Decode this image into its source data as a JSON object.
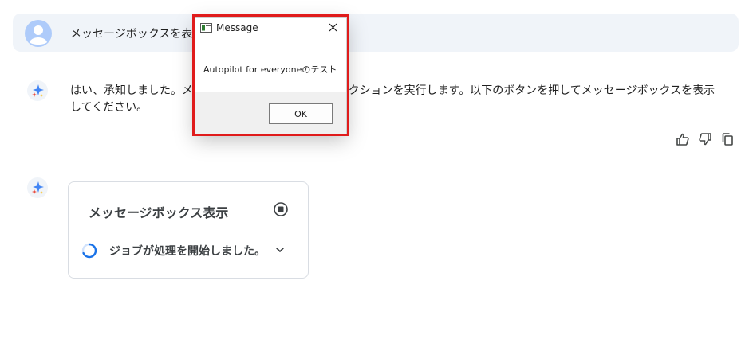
{
  "user_message": {
    "text": "メッセージボックスを表示して",
    "avatar_icon": "user-avatar-icon"
  },
  "assistant_reply": {
    "text": "はい、承知しました。メッセージボックスを表示するアクションを実行します。以下のボタンを押してメッセージボックスを表示してください。",
    "icon": "sparkle-icon",
    "actions": [
      "thumbs-up-icon",
      "thumbs-down-icon",
      "copy-icon"
    ]
  },
  "action_card": {
    "title": "メッセージボックス表示",
    "status": "ジョブが処理を開始しました。",
    "stop_icon": "stop-icon",
    "expand_icon": "chevron-down-icon"
  },
  "dialog": {
    "title": "Message",
    "message": "Autopilot for everyoneのテスト",
    "ok_label": "OK",
    "highlight_color": "#e01b1b"
  },
  "colors": {
    "prompt_bg": "#f0f4f9",
    "card_border": "#d9dde3",
    "spinner": "#1a73e8"
  }
}
